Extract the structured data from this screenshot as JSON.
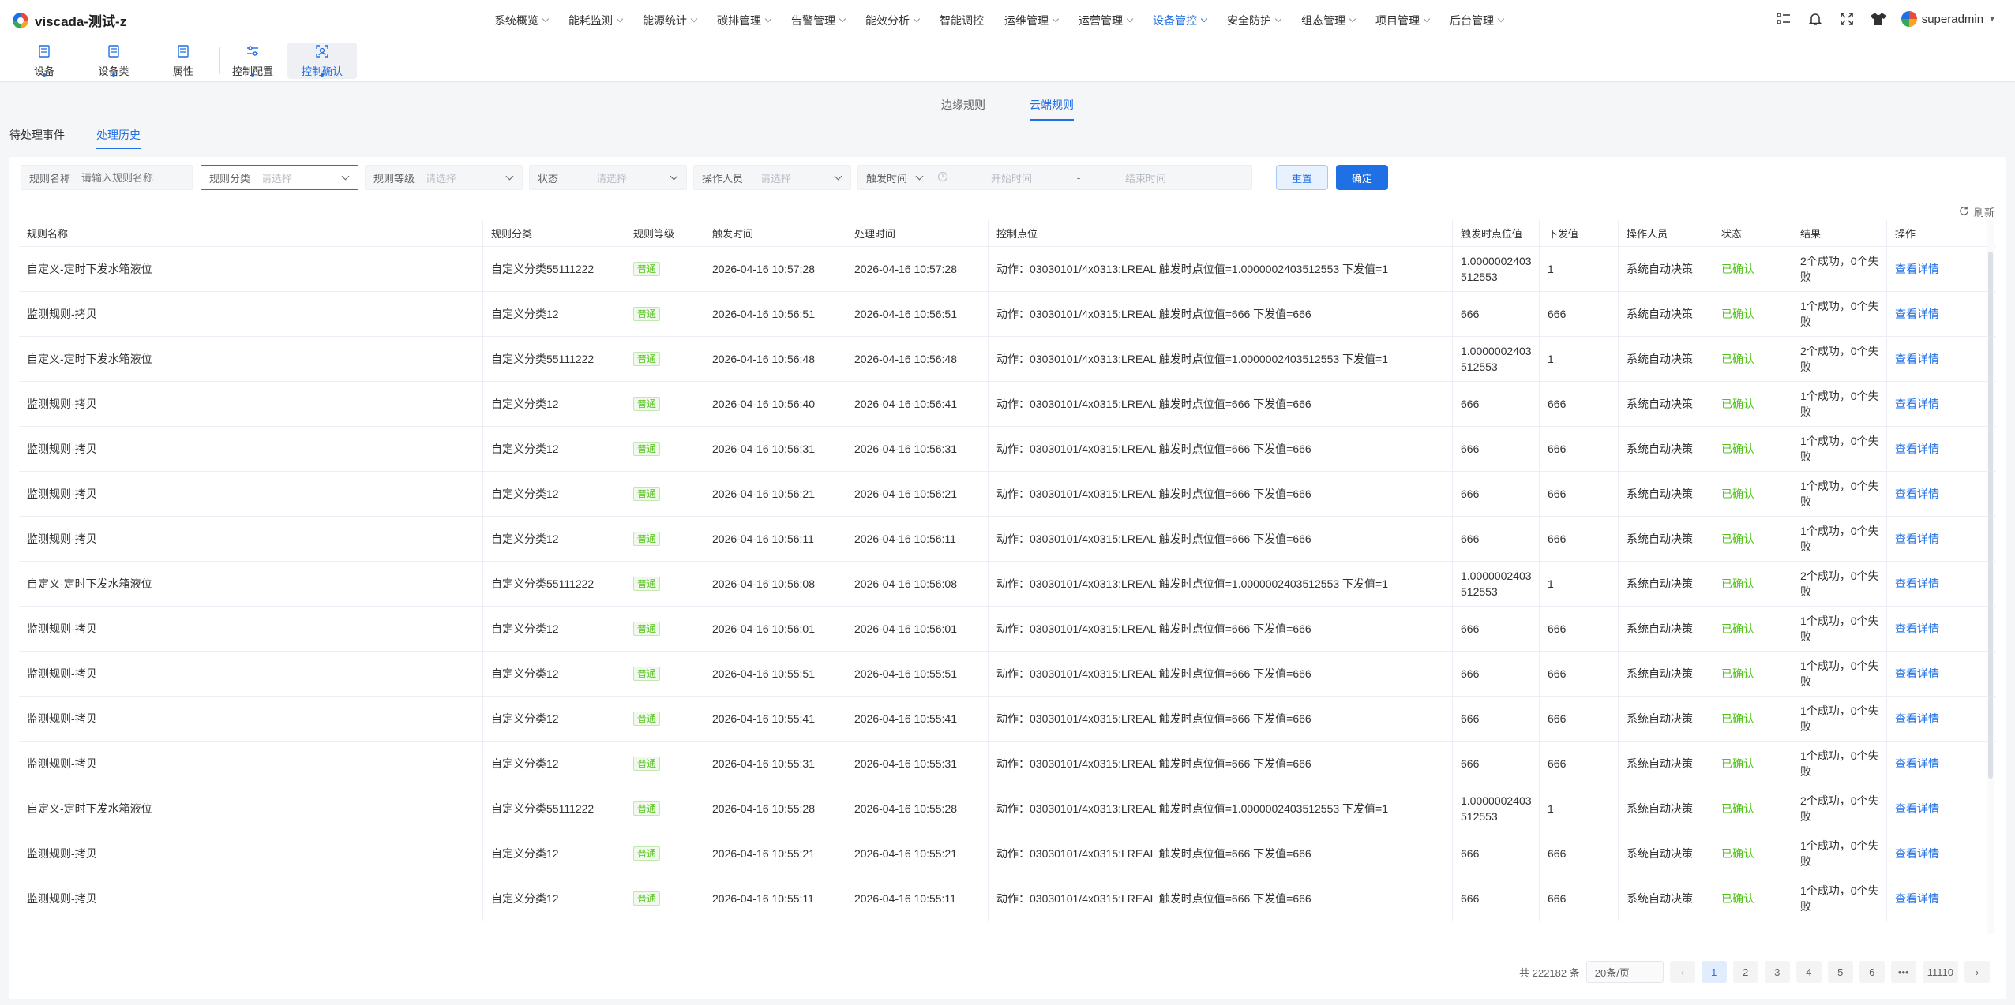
{
  "app": {
    "title": "viscada-测试-z"
  },
  "nav": {
    "items": [
      {
        "label": "系统概览",
        "active": false
      },
      {
        "label": "能耗监测",
        "active": false
      },
      {
        "label": "能源统计",
        "active": false
      },
      {
        "label": "碳排管理",
        "active": false
      },
      {
        "label": "告警管理",
        "active": false
      },
      {
        "label": "能效分析",
        "active": false
      },
      {
        "label": "智能调控",
        "active": false
      },
      {
        "label": "运维管理",
        "active": false
      },
      {
        "label": "运营管理",
        "active": false
      },
      {
        "label": "设备管控",
        "active": true
      },
      {
        "label": "安全防护",
        "active": false
      },
      {
        "label": "组态管理",
        "active": false
      },
      {
        "label": "项目管理",
        "active": false
      },
      {
        "label": "后台管理",
        "active": false
      }
    ]
  },
  "user": {
    "name": "superadmin"
  },
  "subtools": [
    {
      "label": "设备",
      "icon": "device-icon"
    },
    {
      "label": "设备类",
      "icon": "device-class-icon"
    },
    {
      "label": "属性",
      "icon": "attribute-icon"
    },
    {
      "label": "控制配置",
      "icon": "control-config-icon"
    },
    {
      "label": "控制确认",
      "icon": "control-confirm-icon"
    }
  ],
  "rule_tabs": {
    "edge": "边缘规则",
    "cloud": "云端规则"
  },
  "event_tabs": {
    "pending": "待处理事件",
    "history": "处理历史"
  },
  "filters": {
    "rule_name_label": "规则名称",
    "rule_name_placeholder": "请输入规则名称",
    "rule_category_label": "规则分类",
    "rule_level_label": "规则等级",
    "status_label": "状态",
    "operator_label": "操作人员",
    "select_placeholder": "请选择",
    "trigger_time_label": "触发时间",
    "start_time": "开始时间",
    "range_sep": "-",
    "end_time": "结束时间",
    "reset": "重置",
    "confirm": "确定"
  },
  "refresh_label": "刷新",
  "table": {
    "headers": [
      "规则名称",
      "规则分类",
      "规则等级",
      "触发时间",
      "处理时间",
      "控制点位",
      "触发时点位值",
      "下发值",
      "操作人员",
      "状态",
      "结果",
      "操作"
    ],
    "rows": [
      [
        "自定义-定时下发水箱液位",
        "自定义分类55111222",
        "普通",
        "2026-04-16 10:57:28",
        "2026-04-16 10:57:28",
        "动作：03030101/4x0313:LREAL 触发时点位值=1.0000002403512553 下发值=1",
        "1.0000002403512553",
        "1",
        "系统自动决策",
        "已确认",
        "2个成功，0个失败",
        "查看详情"
      ],
      [
        "监测规则-拷贝",
        "自定义分类12",
        "普通",
        "2026-04-16 10:56:51",
        "2026-04-16 10:56:51",
        "动作：03030101/4x0315:LREAL 触发时点位值=666 下发值=666",
        "666",
        "666",
        "系统自动决策",
        "已确认",
        "1个成功，0个失败",
        "查看详情"
      ],
      [
        "自定义-定时下发水箱液位",
        "自定义分类55111222",
        "普通",
        "2026-04-16 10:56:48",
        "2026-04-16 10:56:48",
        "动作：03030101/4x0313:LREAL 触发时点位值=1.0000002403512553 下发值=1",
        "1.0000002403512553",
        "1",
        "系统自动决策",
        "已确认",
        "2个成功，0个失败",
        "查看详情"
      ],
      [
        "监测规则-拷贝",
        "自定义分类12",
        "普通",
        "2026-04-16 10:56:40",
        "2026-04-16 10:56:41",
        "动作：03030101/4x0315:LREAL 触发时点位值=666 下发值=666",
        "666",
        "666",
        "系统自动决策",
        "已确认",
        "1个成功，0个失败",
        "查看详情"
      ],
      [
        "监测规则-拷贝",
        "自定义分类12",
        "普通",
        "2026-04-16 10:56:31",
        "2026-04-16 10:56:31",
        "动作：03030101/4x0315:LREAL 触发时点位值=666 下发值=666",
        "666",
        "666",
        "系统自动决策",
        "已确认",
        "1个成功，0个失败",
        "查看详情"
      ],
      [
        "监测规则-拷贝",
        "自定义分类12",
        "普通",
        "2026-04-16 10:56:21",
        "2026-04-16 10:56:21",
        "动作：03030101/4x0315:LREAL 触发时点位值=666 下发值=666",
        "666",
        "666",
        "系统自动决策",
        "已确认",
        "1个成功，0个失败",
        "查看详情"
      ],
      [
        "监测规则-拷贝",
        "自定义分类12",
        "普通",
        "2026-04-16 10:56:11",
        "2026-04-16 10:56:11",
        "动作：03030101/4x0315:LREAL 触发时点位值=666 下发值=666",
        "666",
        "666",
        "系统自动决策",
        "已确认",
        "1个成功，0个失败",
        "查看详情"
      ],
      [
        "自定义-定时下发水箱液位",
        "自定义分类55111222",
        "普通",
        "2026-04-16 10:56:08",
        "2026-04-16 10:56:08",
        "动作：03030101/4x0313:LREAL 触发时点位值=1.0000002403512553 下发值=1",
        "1.0000002403512553",
        "1",
        "系统自动决策",
        "已确认",
        "2个成功，0个失败",
        "查看详情"
      ],
      [
        "监测规则-拷贝",
        "自定义分类12",
        "普通",
        "2026-04-16 10:56:01",
        "2026-04-16 10:56:01",
        "动作：03030101/4x0315:LREAL 触发时点位值=666 下发值=666",
        "666",
        "666",
        "系统自动决策",
        "已确认",
        "1个成功，0个失败",
        "查看详情"
      ],
      [
        "监测规则-拷贝",
        "自定义分类12",
        "普通",
        "2026-04-16 10:55:51",
        "2026-04-16 10:55:51",
        "动作：03030101/4x0315:LREAL 触发时点位值=666 下发值=666",
        "666",
        "666",
        "系统自动决策",
        "已确认",
        "1个成功，0个失败",
        "查看详情"
      ],
      [
        "监测规则-拷贝",
        "自定义分类12",
        "普通",
        "2026-04-16 10:55:41",
        "2026-04-16 10:55:41",
        "动作：03030101/4x0315:LREAL 触发时点位值=666 下发值=666",
        "666",
        "666",
        "系统自动决策",
        "已确认",
        "1个成功，0个失败",
        "查看详情"
      ],
      [
        "监测规则-拷贝",
        "自定义分类12",
        "普通",
        "2026-04-16 10:55:31",
        "2026-04-16 10:55:31",
        "动作：03030101/4x0315:LREAL 触发时点位值=666 下发值=666",
        "666",
        "666",
        "系统自动决策",
        "已确认",
        "1个成功，0个失败",
        "查看详情"
      ],
      [
        "自定义-定时下发水箱液位",
        "自定义分类55111222",
        "普通",
        "2026-04-16 10:55:28",
        "2026-04-16 10:55:28",
        "动作：03030101/4x0313:LREAL 触发时点位值=1.0000002403512553 下发值=1",
        "1.0000002403512553",
        "1",
        "系统自动决策",
        "已确认",
        "2个成功，0个失败",
        "查看详情"
      ],
      [
        "监测规则-拷贝",
        "自定义分类12",
        "普通",
        "2026-04-16 10:55:21",
        "2026-04-16 10:55:21",
        "动作：03030101/4x0315:LREAL 触发时点位值=666 下发值=666",
        "666",
        "666",
        "系统自动决策",
        "已确认",
        "1个成功，0个失败",
        "查看详情"
      ],
      [
        "监测规则-拷贝",
        "自定义分类12",
        "普通",
        "2026-04-16 10:55:11",
        "2026-04-16 10:55:11",
        "动作：03030101/4x0315:LREAL 触发时点位值=666 下发值=666",
        "666",
        "666",
        "系统自动决策",
        "已确认",
        "1个成功，0个失败",
        "查看详情"
      ]
    ]
  },
  "pagination": {
    "total": "共 222182 条",
    "page_size": "20条/页",
    "pages": [
      "1",
      "2",
      "3",
      "4",
      "5",
      "6",
      "•••",
      "11110"
    ],
    "active_page": "1"
  },
  "colors": {
    "primary": "#1f6fe5",
    "success": "#52c41a"
  }
}
